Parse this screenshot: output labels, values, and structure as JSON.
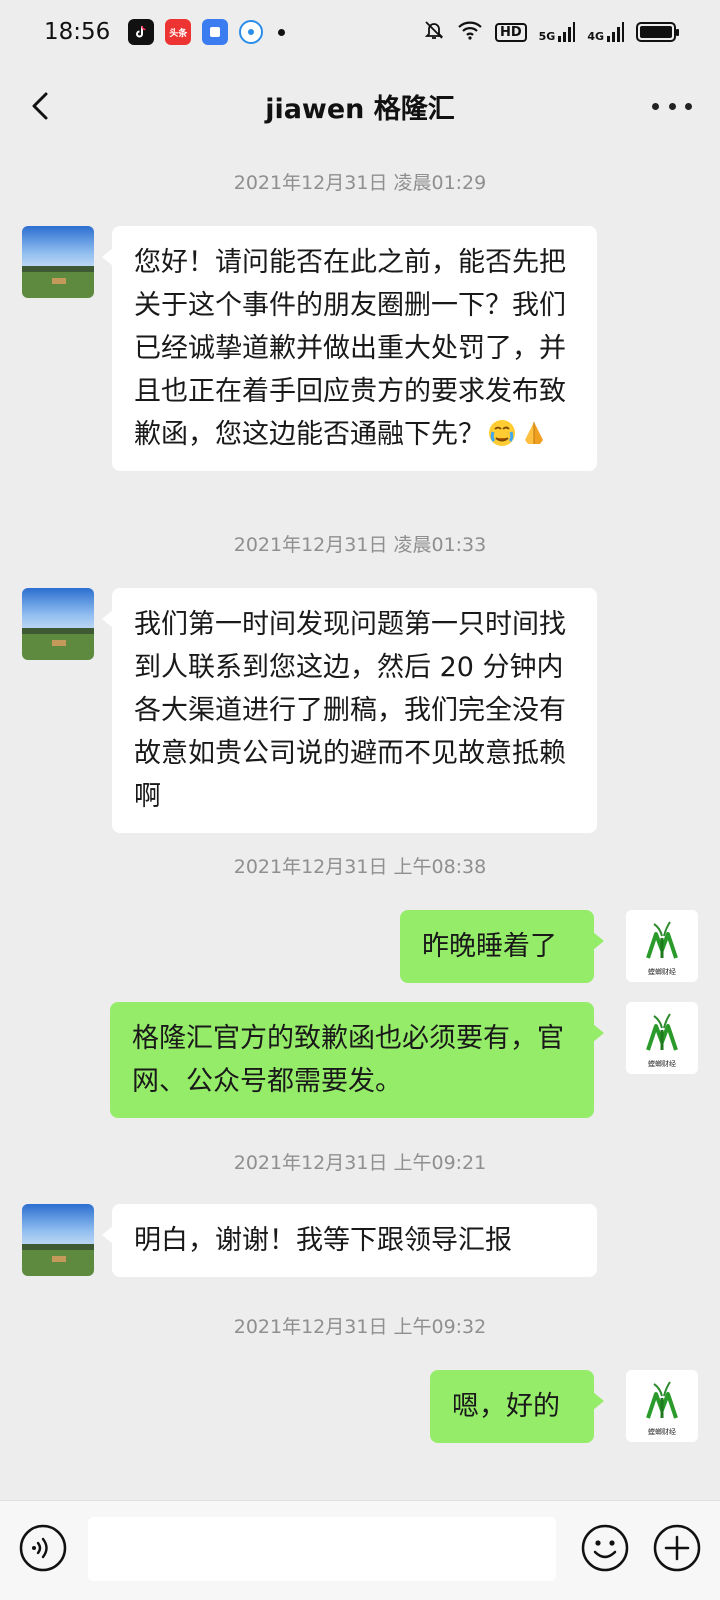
{
  "status_bar": {
    "time": "18:56",
    "app_icons": [
      "tiktok-icon",
      "toutiao-icon",
      "blue-square-icon",
      "blue-circle-icon"
    ],
    "toutiao_label": "头条",
    "indicators": [
      "mute-icon",
      "wifi-icon",
      "hd-icon",
      "5g-signal-icon",
      "4g-signal-icon",
      "battery-icon"
    ],
    "hd_label": "HD",
    "signal_5g": "5G",
    "signal_4g": "4G"
  },
  "nav": {
    "title": "jiawen 格隆汇",
    "back_icon": "chevron-left-icon",
    "more_icon": "more-icon"
  },
  "messages": [
    {
      "type": "timestamp",
      "text": "2021年12月31日 凌晨01:29"
    },
    {
      "type": "incoming",
      "avatar": "landscape-avatar",
      "text": "您好！请问能否在此之前，能否先把关于这个事件的朋友圈删一下？我们已经诚挚道歉并做出重大处罚了，并且也正在着手回应贵方的要求发布致歉函，您这边能否通融下先？",
      "emojis": [
        "crying-face-emoji",
        "folded-hands-emoji"
      ]
    },
    {
      "type": "timestamp",
      "text": "2021年12月31日 凌晨01:33"
    },
    {
      "type": "incoming",
      "avatar": "landscape-avatar",
      "text": "我们第一时间发现问题第一只时间找到人联系到您这边，然后 20 分钟内各大渠道进行了删稿，我们完全没有故意如贵公司说的避而不见故意抵赖啊"
    },
    {
      "type": "timestamp",
      "text": "2021年12月31日 上午08:38"
    },
    {
      "type": "outgoing",
      "avatar": "mantis-logo-avatar",
      "text": "昨晚睡着了"
    },
    {
      "type": "outgoing",
      "avatar": "mantis-logo-avatar",
      "text": "格隆汇官方的致歉函也必须要有，官网、公众号都需要发。"
    },
    {
      "type": "timestamp",
      "text": "2021年12月31日 上午09:21"
    },
    {
      "type": "incoming",
      "avatar": "landscape-avatar",
      "text": "明白，谢谢！我等下跟领导汇报"
    },
    {
      "type": "timestamp",
      "text": "2021年12月31日 上午09:32"
    },
    {
      "type": "outgoing",
      "avatar": "mantis-logo-avatar",
      "text": "嗯，好的"
    }
  ],
  "logo_text": "螳螂财经",
  "input_bar": {
    "voice_icon": "voice-icon",
    "input_value": "",
    "emoji_icon": "smiley-icon",
    "plus_icon": "plus-icon"
  },
  "colors": {
    "background": "#ededed",
    "incoming_bubble": "#ffffff",
    "outgoing_bubble": "#95ec69",
    "timestamp_text": "#8f8f8f"
  }
}
